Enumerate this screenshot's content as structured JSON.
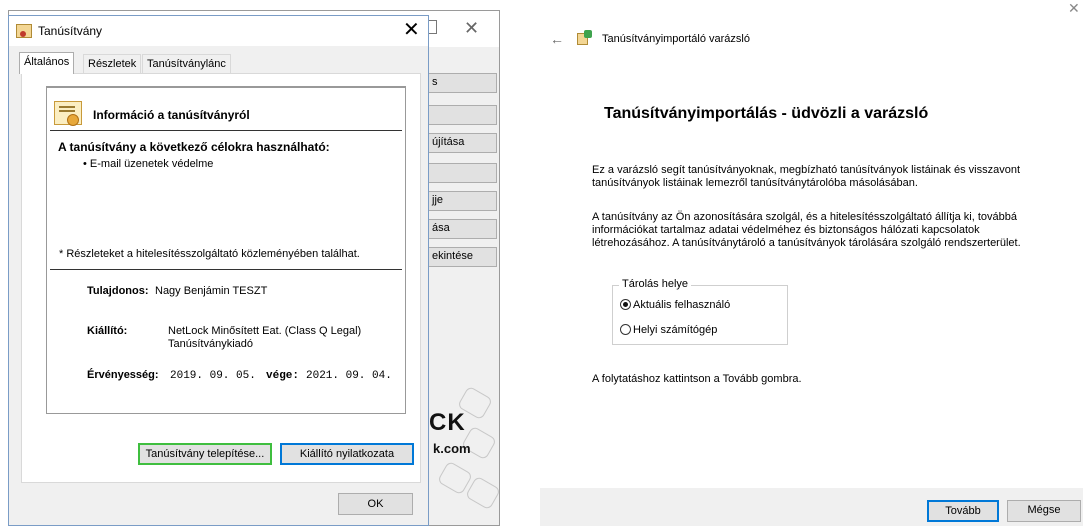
{
  "dialog": {
    "title": "Tanúsítvány",
    "tabs": [
      "Általános",
      "Részletek",
      "Tanúsítványlánc"
    ],
    "info_heading": "Információ a tanúsítványról",
    "purpose_heading": "A tanúsítvány a következő célokra használható:",
    "purposes": [
      "• E-mail üzenetek védelme"
    ],
    "footnote": "* Részleteket a hitelesítésszolgáltató közleményében találhat.",
    "issued_to_label": "Tulajdonos:",
    "issued_to_value": "Nagy Benjámin TESZT",
    "issuer_label": "Kiállító:",
    "issuer_value_line1": "NetLock Minősített Eat. (Class Q Legal)",
    "issuer_value_line2": "Tanúsítványkiadó",
    "validity_label": "Érvényesség:",
    "valid_from": "2019. 09. 05.",
    "valid_to_label": "vége:",
    "valid_to": "2021. 09. 04.",
    "install_button": "Tanúsítvány telepítése...",
    "issuer_statement_button": "Kiállító nyilatkozata",
    "ok_button": "OK"
  },
  "background_window": {
    "buttons": [
      "s",
      "",
      "újítása",
      "",
      "jje",
      "ása",
      "ekintése"
    ],
    "brand": "CK",
    "domain": "k.com"
  },
  "wizard": {
    "title": "Tanúsítványimportáló varázsló",
    "heading": "Tanúsítványimportálás - üdvözli a varázsló",
    "para1_line1": "Ez a varázsló segít tanúsítványoknak, megbízható tanúsítványok listáinak és visszavont",
    "para1_line2": "tanúsítványok listáinak lemezről tanúsítványtárolóba másolásában.",
    "para2_line1": "A tanúsítvány az Ön azonosítására szolgál, és a hitelesítésszolgáltató állítja ki, továbbá",
    "para2_line2": "információkat tartalmaz adatai védelméhez és biztonságos hálózati kapcsolatok",
    "para2_line3": "létrehozásához. A tanúsítványtároló a tanúsítványok tárolására szolgáló rendszerterület.",
    "store_legend": "Tárolás helye",
    "option_current_user": "Aktuális felhasználó",
    "option_local_machine": "Helyi számítógép",
    "selected_option": "current_user",
    "continue_text": "A folytatáshoz kattintson a Tovább gombra.",
    "next_button": "Tovább",
    "cancel_button": "Mégse"
  }
}
